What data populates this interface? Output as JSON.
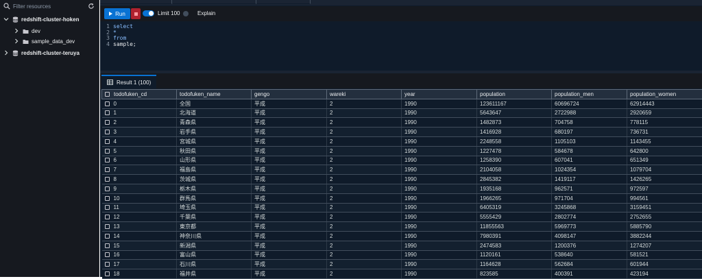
{
  "sidebar": {
    "filter_placeholder": "Filter resources",
    "tree": [
      {
        "label": "redshift-cluster-hoken",
        "level": 0,
        "expanded": true,
        "bold": true
      },
      {
        "label": "dev",
        "level": 1,
        "expanded": false,
        "bold": false
      },
      {
        "label": "sample_data_dev",
        "level": 1,
        "expanded": false,
        "bold": false
      },
      {
        "label": "redshift-cluster-teruya",
        "level": 0,
        "expanded": false,
        "bold": true
      }
    ]
  },
  "toolbar": {
    "run_label": "Run",
    "limit_label": "Limit 100",
    "explain_label": "Explain"
  },
  "editor": {
    "lines": [
      {
        "num": "1",
        "text": "select",
        "kind": "kw"
      },
      {
        "num": "2",
        "text": "*",
        "kind": "kw"
      },
      {
        "num": "3",
        "text": "from",
        "kind": "kw"
      },
      {
        "num": "4",
        "text": "sample;",
        "kind": "plain"
      }
    ]
  },
  "results": {
    "tab_label": "Result 1 (100)",
    "columns": [
      "todofuken_cd",
      "todofuken_name",
      "gengo",
      "wareki",
      "year",
      "population",
      "population_men",
      "population_women"
    ],
    "rows": [
      [
        "0",
        "全国",
        "平成",
        "2",
        "1990",
        "123611167",
        "60696724",
        "62914443"
      ],
      [
        "1",
        "北海道",
        "平成",
        "2",
        "1990",
        "5643647",
        "2722988",
        "2920659"
      ],
      [
        "2",
        "青森県",
        "平成",
        "2",
        "1990",
        "1482873",
        "704758",
        "778115"
      ],
      [
        "3",
        "岩手県",
        "平成",
        "2",
        "1990",
        "1416928",
        "680197",
        "736731"
      ],
      [
        "4",
        "宮城県",
        "平成",
        "2",
        "1990",
        "2248558",
        "1105103",
        "1143455"
      ],
      [
        "5",
        "秋田県",
        "平成",
        "2",
        "1990",
        "1227478",
        "584678",
        "642800"
      ],
      [
        "6",
        "山形県",
        "平成",
        "2",
        "1990",
        "1258390",
        "607041",
        "651349"
      ],
      [
        "7",
        "福島県",
        "平成",
        "2",
        "1990",
        "2104058",
        "1024354",
        "1079704"
      ],
      [
        "8",
        "茨城県",
        "平成",
        "2",
        "1990",
        "2845382",
        "1419117",
        "1426265"
      ],
      [
        "9",
        "栃木県",
        "平成",
        "2",
        "1990",
        "1935168",
        "962571",
        "972597"
      ],
      [
        "10",
        "群馬県",
        "平成",
        "2",
        "1990",
        "1966265",
        "971704",
        "994561"
      ],
      [
        "11",
        "埼玉県",
        "平成",
        "2",
        "1990",
        "6405319",
        "3245868",
        "3159451"
      ],
      [
        "12",
        "千葉県",
        "平成",
        "2",
        "1990",
        "5555429",
        "2802774",
        "2752655"
      ],
      [
        "13",
        "東京都",
        "平成",
        "2",
        "1990",
        "11855563",
        "5969773",
        "5885790"
      ],
      [
        "14",
        "神奈川県",
        "平成",
        "2",
        "1990",
        "7980391",
        "4098147",
        "3882244"
      ],
      [
        "15",
        "新潟県",
        "平成",
        "2",
        "1990",
        "2474583",
        "1200376",
        "1274207"
      ],
      [
        "16",
        "富山県",
        "平成",
        "2",
        "1990",
        "1120161",
        "538640",
        "581521"
      ],
      [
        "17",
        "石川県",
        "平成",
        "2",
        "1990",
        "1164628",
        "562684",
        "601944"
      ],
      [
        "18",
        "福井県",
        "平成",
        "2",
        "1990",
        "823585",
        "400391",
        "423194"
      ]
    ]
  },
  "colors": {
    "accent": "#0972d3",
    "stop": "#b0222f",
    "background": "#0f1b2a",
    "sidebar": "#16191f"
  }
}
